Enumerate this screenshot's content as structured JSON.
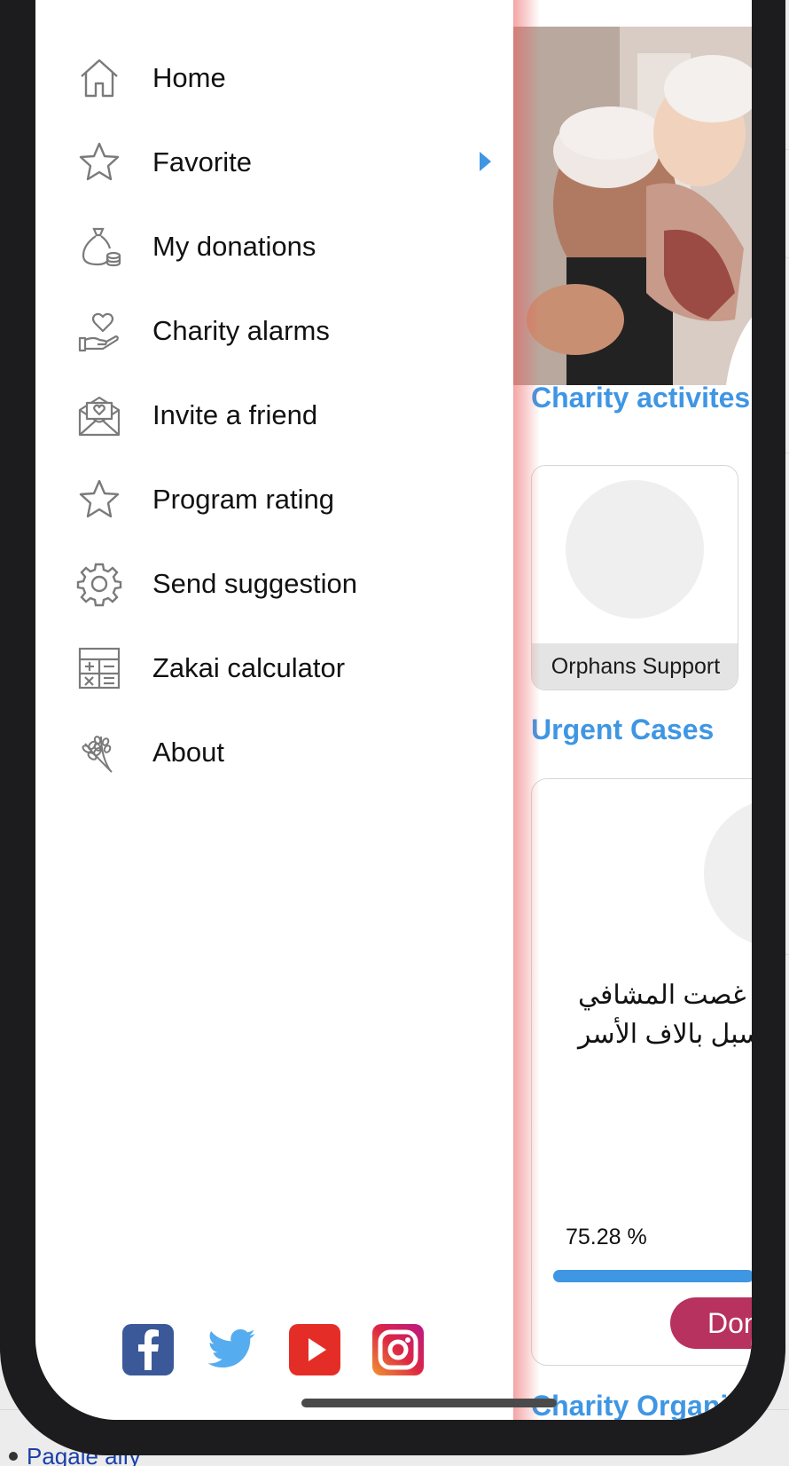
{
  "drawer": {
    "items": [
      {
        "label": "Home",
        "icon": "home-icon"
      },
      {
        "label": "Favorite",
        "icon": "star-icon",
        "has_arrow": true
      },
      {
        "label": "My donations",
        "icon": "money-bag-icon"
      },
      {
        "label": "Charity alarms",
        "icon": "hand-heart-icon"
      },
      {
        "label": "Invite a friend",
        "icon": "envelope-icon"
      },
      {
        "label": "Program rating",
        "icon": "star-icon"
      },
      {
        "label": "Send suggestion",
        "icon": "gear-icon"
      },
      {
        "label": "Zakai calculator",
        "icon": "calculator-icon"
      },
      {
        "label": "About",
        "icon": "wheat-icon"
      }
    ],
    "socials": [
      {
        "name": "facebook-icon",
        "color": "#3b5998"
      },
      {
        "name": "twitter-icon",
        "color": "#55acee"
      },
      {
        "name": "youtube-icon",
        "color": "#e52d27"
      },
      {
        "name": "instagram-icon",
        "color": "#c13584"
      }
    ]
  },
  "app": {
    "sections": {
      "activities": "Charity activites",
      "urgent": "Urgent Cases",
      "organizations": "Charity Organi"
    },
    "activity_card": {
      "label": "Orphans Support"
    },
    "urgent_card": {
      "text_line1": "غصت المشافي",
      "text_line2": "سبل بالاف الأسر",
      "percent_text": "75.28 %",
      "progress": 0.7528,
      "donate_label": "Don"
    },
    "accent_color": "#3f96e3",
    "donate_color": "#b8325f"
  },
  "background": {
    "bottom_link": "Pagaie alfy"
  }
}
